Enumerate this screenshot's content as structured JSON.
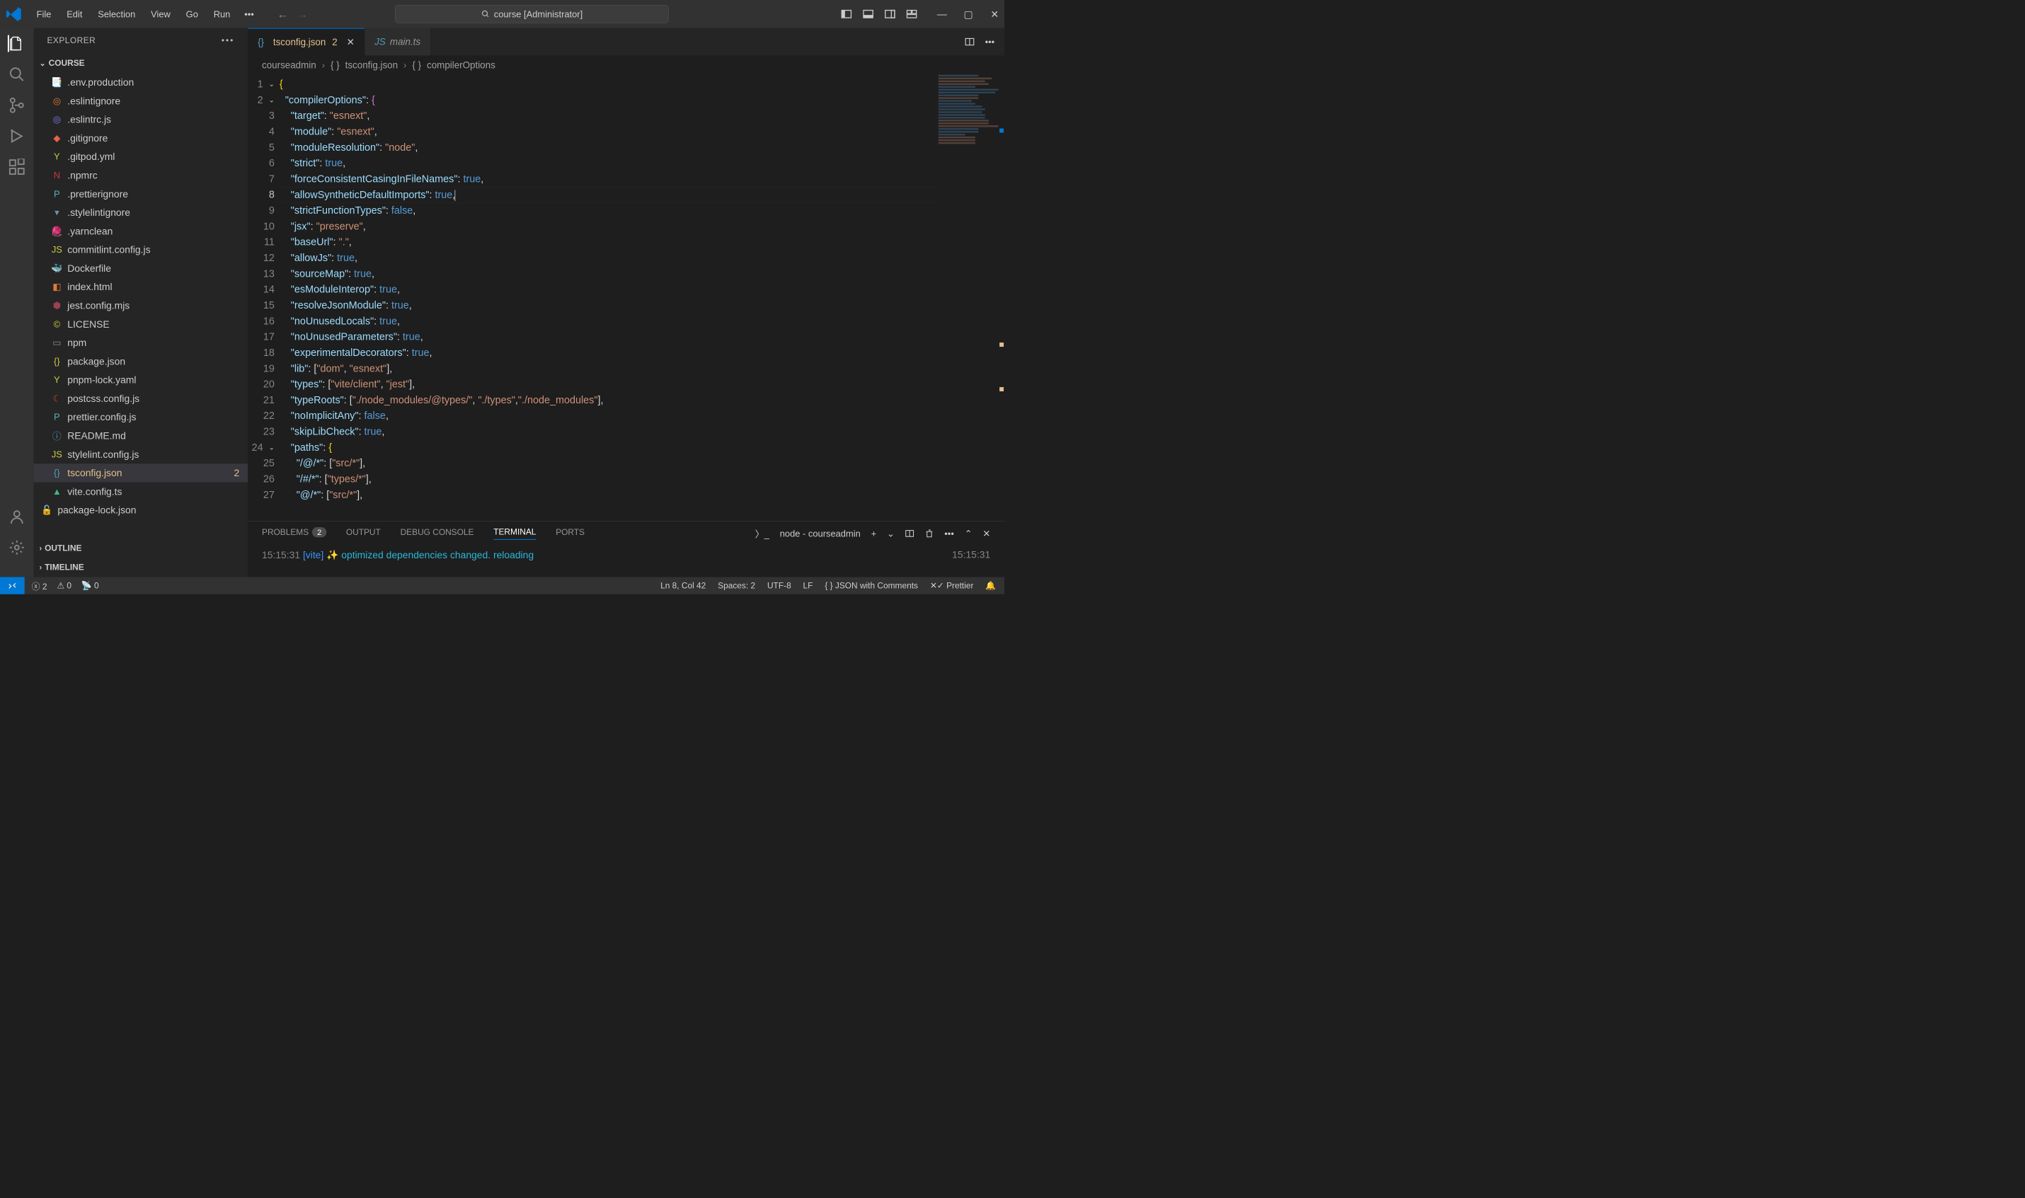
{
  "menu": [
    "File",
    "Edit",
    "Selection",
    "View",
    "Go",
    "Run"
  ],
  "search_text": "course [Administrator]",
  "explorer_title": "EXPLORER",
  "project": "COURSE",
  "files": [
    {
      "icon": "📑",
      "color": "#519aba",
      "name": ".env.production"
    },
    {
      "icon": "◎",
      "color": "#e37933",
      "name": ".eslintignore"
    },
    {
      "icon": "◎",
      "color": "#8080f2",
      "name": ".eslintrc.js"
    },
    {
      "icon": "◆",
      "color": "#e8604c",
      "name": ".gitignore"
    },
    {
      "icon": "Y",
      "color": "#cbcb41",
      "name": ".gitpod.yml"
    },
    {
      "icon": "N",
      "color": "#cb3837",
      "name": ".npmrc"
    },
    {
      "icon": "P",
      "color": "#56b3b4",
      "name": ".prettierignore"
    },
    {
      "icon": "▾",
      "color": "#6994b7",
      "name": ".stylelintignore"
    },
    {
      "icon": "🧶",
      "color": "#368fb9",
      "name": ".yarnclean"
    },
    {
      "icon": "JS",
      "color": "#cbcb41",
      "name": "commitlint.config.js"
    },
    {
      "icon": "🐳",
      "color": "#519aba",
      "name": "Dockerfile"
    },
    {
      "icon": "◧",
      "color": "#e37933",
      "name": "index.html"
    },
    {
      "icon": "⬢",
      "color": "#99424f",
      "name": "jest.config.mjs"
    },
    {
      "icon": "©",
      "color": "#cbcb41",
      "name": "LICENSE"
    },
    {
      "icon": "▭",
      "color": "#8a8a8a",
      "name": "npm"
    },
    {
      "icon": "{}",
      "color": "#cbcb41",
      "name": "package.json"
    },
    {
      "icon": "Y",
      "color": "#cbcb41",
      "name": "pnpm-lock.yaml"
    },
    {
      "icon": "☾",
      "color": "#d6461e",
      "name": "postcss.config.js"
    },
    {
      "icon": "P",
      "color": "#56b3b4",
      "name": "prettier.config.js"
    },
    {
      "icon": "ⓘ",
      "color": "#519aba",
      "name": "README.md"
    },
    {
      "icon": "JS",
      "color": "#cbcb41",
      "name": "stylelint.config.js"
    },
    {
      "icon": "{}",
      "color": "#519aba",
      "name": "tsconfig.json",
      "sel": true,
      "badge": "2"
    },
    {
      "icon": "▲",
      "color": "#41b883",
      "name": "vite.config.ts"
    }
  ],
  "git_file": {
    "icon": "🔒",
    "name": "package-lock.json"
  },
  "outline": "OUTLINE",
  "timeline": "TIMELINE",
  "tabs": [
    {
      "icon": "{}",
      "name": "tsconfig.json",
      "err": "2",
      "active": true
    },
    {
      "icon": "JS",
      "name": "main.ts",
      "active": false,
      "italic": true
    }
  ],
  "breadcrumb": [
    "courseadmin",
    "tsconfig.json",
    "compilerOptions"
  ],
  "code": {
    "lines": [
      [
        {
          "t": "{",
          "c": "b"
        }
      ],
      [
        {
          "t": "  ",
          "c": "p"
        },
        {
          "t": "\"compilerOptions\"",
          "c": "k"
        },
        {
          "t": ": ",
          "c": "p"
        },
        {
          "t": "{",
          "c": "br"
        }
      ],
      [
        {
          "t": "    ",
          "c": "p"
        },
        {
          "t": "\"target\"",
          "c": "k"
        },
        {
          "t": ": ",
          "c": "p"
        },
        {
          "t": "\"esnext\"",
          "c": "s"
        },
        {
          "t": ",",
          "c": "p"
        }
      ],
      [
        {
          "t": "    ",
          "c": "p"
        },
        {
          "t": "\"module\"",
          "c": "k"
        },
        {
          "t": ": ",
          "c": "p"
        },
        {
          "t": "\"esnext\"",
          "c": "s"
        },
        {
          "t": ",",
          "c": "p"
        }
      ],
      [
        {
          "t": "    ",
          "c": "p"
        },
        {
          "t": "\"moduleResolution\"",
          "c": "k"
        },
        {
          "t": ": ",
          "c": "p"
        },
        {
          "t": "\"node\"",
          "c": "s"
        },
        {
          "t": ",",
          "c": "p"
        }
      ],
      [
        {
          "t": "    ",
          "c": "p"
        },
        {
          "t": "\"strict\"",
          "c": "k"
        },
        {
          "t": ": ",
          "c": "p"
        },
        {
          "t": "true",
          "c": "v"
        },
        {
          "t": ",",
          "c": "p"
        }
      ],
      [
        {
          "t": "    ",
          "c": "p"
        },
        {
          "t": "\"forceConsistentCasingInFileNames\"",
          "c": "k"
        },
        {
          "t": ": ",
          "c": "p"
        },
        {
          "t": "true",
          "c": "v"
        },
        {
          "t": ",",
          "c": "p"
        }
      ],
      [
        {
          "t": "    ",
          "c": "p"
        },
        {
          "t": "\"allowSyntheticDefaultImports\"",
          "c": "k"
        },
        {
          "t": ": ",
          "c": "p"
        },
        {
          "t": "true",
          "c": "v"
        },
        {
          "t": ",",
          "c": "p"
        }
      ],
      [
        {
          "t": "    ",
          "c": "p"
        },
        {
          "t": "\"strictFunctionTypes\"",
          "c": "k"
        },
        {
          "t": ": ",
          "c": "p"
        },
        {
          "t": "false",
          "c": "v"
        },
        {
          "t": ",",
          "c": "p"
        }
      ],
      [
        {
          "t": "    ",
          "c": "p"
        },
        {
          "t": "\"jsx\"",
          "c": "k"
        },
        {
          "t": ": ",
          "c": "p"
        },
        {
          "t": "\"preserve\"",
          "c": "s"
        },
        {
          "t": ",",
          "c": "p"
        }
      ],
      [
        {
          "t": "    ",
          "c": "p"
        },
        {
          "t": "\"baseUrl\"",
          "c": "k"
        },
        {
          "t": ": ",
          "c": "p"
        },
        {
          "t": "\".\"",
          "c": "s"
        },
        {
          "t": ",",
          "c": "p"
        }
      ],
      [
        {
          "t": "    ",
          "c": "p"
        },
        {
          "t": "\"allowJs\"",
          "c": "k"
        },
        {
          "t": ": ",
          "c": "p"
        },
        {
          "t": "true",
          "c": "v"
        },
        {
          "t": ",",
          "c": "p"
        }
      ],
      [
        {
          "t": "    ",
          "c": "p"
        },
        {
          "t": "\"sourceMap\"",
          "c": "k"
        },
        {
          "t": ": ",
          "c": "p"
        },
        {
          "t": "true",
          "c": "v"
        },
        {
          "t": ",",
          "c": "p"
        }
      ],
      [
        {
          "t": "    ",
          "c": "p"
        },
        {
          "t": "\"esModuleInterop\"",
          "c": "k"
        },
        {
          "t": ": ",
          "c": "p"
        },
        {
          "t": "true",
          "c": "v"
        },
        {
          "t": ",",
          "c": "p"
        }
      ],
      [
        {
          "t": "    ",
          "c": "p"
        },
        {
          "t": "\"resolveJsonModule\"",
          "c": "k"
        },
        {
          "t": ": ",
          "c": "p"
        },
        {
          "t": "true",
          "c": "v"
        },
        {
          "t": ",",
          "c": "p"
        }
      ],
      [
        {
          "t": "    ",
          "c": "p"
        },
        {
          "t": "\"noUnusedLocals\"",
          "c": "k"
        },
        {
          "t": ": ",
          "c": "p"
        },
        {
          "t": "true",
          "c": "v"
        },
        {
          "t": ",",
          "c": "p"
        }
      ],
      [
        {
          "t": "    ",
          "c": "p"
        },
        {
          "t": "\"noUnusedParameters\"",
          "c": "k"
        },
        {
          "t": ": ",
          "c": "p"
        },
        {
          "t": "true",
          "c": "v"
        },
        {
          "t": ",",
          "c": "p"
        }
      ],
      [
        {
          "t": "    ",
          "c": "p"
        },
        {
          "t": "\"experimentalDecorators\"",
          "c": "k"
        },
        {
          "t": ": ",
          "c": "p"
        },
        {
          "t": "true",
          "c": "v"
        },
        {
          "t": ",",
          "c": "p"
        }
      ],
      [
        {
          "t": "    ",
          "c": "p"
        },
        {
          "t": "\"lib\"",
          "c": "k"
        },
        {
          "t": ": [",
          "c": "p"
        },
        {
          "t": "\"dom\"",
          "c": "s"
        },
        {
          "t": ", ",
          "c": "p"
        },
        {
          "t": "\"esnext\"",
          "c": "s"
        },
        {
          "t": "],",
          "c": "p"
        }
      ],
      [
        {
          "t": "    ",
          "c": "p"
        },
        {
          "t": "\"types\"",
          "c": "k"
        },
        {
          "t": ": [",
          "c": "p"
        },
        {
          "t": "\"vite/client\"",
          "c": "s"
        },
        {
          "t": ", ",
          "c": "p"
        },
        {
          "t": "\"jest\"",
          "c": "s"
        },
        {
          "t": "],",
          "c": "p"
        }
      ],
      [
        {
          "t": "    ",
          "c": "p"
        },
        {
          "t": "\"typeRoots\"",
          "c": "k"
        },
        {
          "t": ": [",
          "c": "p"
        },
        {
          "t": "\"./node_modules/@types/\"",
          "c": "s"
        },
        {
          "t": ", ",
          "c": "p"
        },
        {
          "t": "\"./types\"",
          "c": "s"
        },
        {
          "t": ",",
          "c": "p"
        },
        {
          "t": "\"./node_modules\"",
          "c": "s"
        },
        {
          "t": "],",
          "c": "p"
        }
      ],
      [
        {
          "t": "    ",
          "c": "p"
        },
        {
          "t": "\"noImplicitAny\"",
          "c": "k"
        },
        {
          "t": ": ",
          "c": "p"
        },
        {
          "t": "false",
          "c": "v"
        },
        {
          "t": ",",
          "c": "p"
        }
      ],
      [
        {
          "t": "    ",
          "c": "p"
        },
        {
          "t": "\"skipLibCheck\"",
          "c": "k"
        },
        {
          "t": ": ",
          "c": "p"
        },
        {
          "t": "true",
          "c": "v"
        },
        {
          "t": ",",
          "c": "p"
        }
      ],
      [
        {
          "t": "    ",
          "c": "p"
        },
        {
          "t": "\"paths\"",
          "c": "k"
        },
        {
          "t": ": ",
          "c": "p"
        },
        {
          "t": "{",
          "c": "b"
        }
      ],
      [
        {
          "t": "      ",
          "c": "p"
        },
        {
          "t": "\"/@/*\"",
          "c": "k"
        },
        {
          "t": ": [",
          "c": "p"
        },
        {
          "t": "\"src/*\"",
          "c": "s"
        },
        {
          "t": "],",
          "c": "p"
        }
      ],
      [
        {
          "t": "      ",
          "c": "p"
        },
        {
          "t": "\"/#/*\"",
          "c": "k"
        },
        {
          "t": ": [",
          "c": "p"
        },
        {
          "t": "\"types/*\"",
          "c": "s"
        },
        {
          "t": "],",
          "c": "p"
        }
      ],
      [
        {
          "t": "      ",
          "c": "p"
        },
        {
          "t": "\"@/*\"",
          "c": "k"
        },
        {
          "t": ": [",
          "c": "p"
        },
        {
          "t": "\"src/*\"",
          "c": "s"
        },
        {
          "t": "],",
          "c": "p"
        }
      ]
    ],
    "current_line": 8
  },
  "panel_tabs": [
    "PROBLEMS",
    "OUTPUT",
    "DEBUG CONSOLE",
    "TERMINAL",
    "PORTS"
  ],
  "panel_active": "TERMINAL",
  "problems_count": "2",
  "terminal_info": "node - courseadmin",
  "terminal_line": {
    "time": "15:15:31",
    "tag": "[vite]",
    "sparkle": "✨",
    "msg1": "optimized",
    "msg2": "dependencies",
    "msg3": "changed.",
    "msg4": "reloading"
  },
  "terminal_time_right": "15:15:31",
  "status": {
    "errors": "2",
    "warnings": "0",
    "ports": "0",
    "ln": "Ln 8, Col 42",
    "spaces": "Spaces: 2",
    "enc": "UTF-8",
    "eol": "LF",
    "lang": "JSON with Comments",
    "prettier": "Prettier"
  }
}
